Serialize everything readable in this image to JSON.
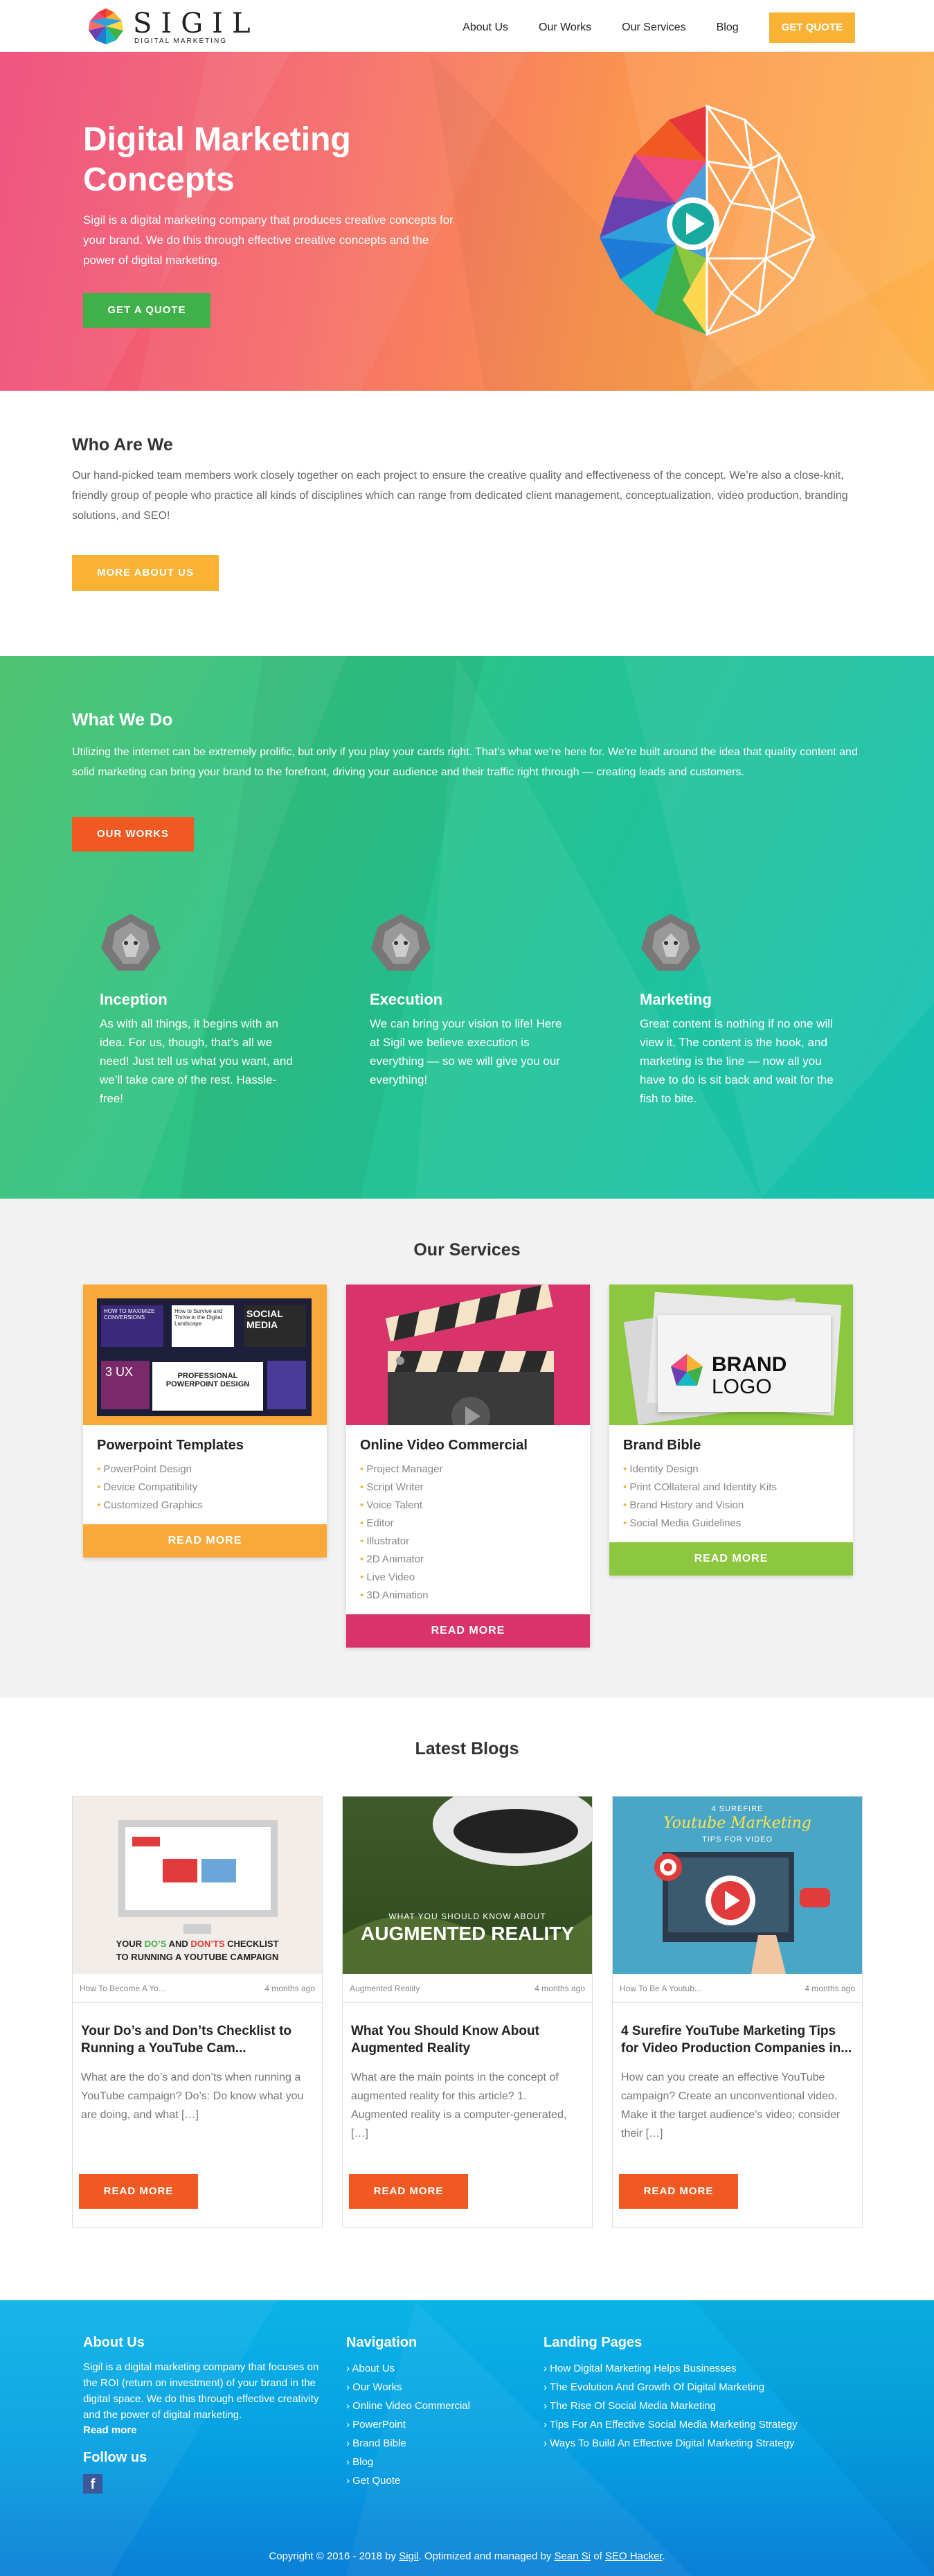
{
  "brand": {
    "name": "SIGIL",
    "tagline": "DIGITAL MARKETING"
  },
  "nav": {
    "about": "About Us",
    "works": "Our Works",
    "services": "Our Services",
    "blog": "Blog",
    "quote": "GET QUOTE"
  },
  "hero": {
    "title": "Digital Marketing Concepts",
    "text": "Sigil is a digital marketing company that produces creative concepts for your brand. We do this through effective creative concepts and the power of digital marketing.",
    "button": "GET A QUOTE"
  },
  "who": {
    "title": "Who Are We",
    "text": "Our hand-picked team members work closely together on each project to ensure the creative quality and effectiveness of the concept. We’re also a close-knit, friendly group of people who practice all kinds of disciplines which can range from dedicated client management, conceptualization, video production, branding solutions, and SEO!",
    "button": "MORE ABOUT US"
  },
  "what": {
    "title": "What We Do",
    "text": "Utilizing the internet can be extremely prolific, but only if you play your cards right. That’s what we’re here for. We’re built around the idea that quality content and solid marketing can bring your brand to the forefront, driving your audience and their traffic right through — creating leads and customers.",
    "button": "OUR WORKS",
    "features": [
      {
        "title": "Inception",
        "text": "As with all things, it begins with an idea. For us, though, that’s all we need! Just tell us what you want, and we’ll take care of the rest. Hassle-free!"
      },
      {
        "title": "Execution",
        "text": "We can bring your vision to life! Here at Sigil we believe execution is everything — so we will give you our everything!"
      },
      {
        "title": "Marketing",
        "text": "Great content is nothing if no one will view it. The content is the hook, and marketing is the line — now all you have to do is sit back and wait for the fish to bite."
      }
    ]
  },
  "services": {
    "title": "Our Services",
    "items": [
      {
        "title": "Powerpoint Templates",
        "list": [
          "PowerPoint Design",
          "Device Compatibility",
          "Customized Graphics"
        ],
        "button": "READ MORE",
        "color": "#f9a93a",
        "img": {
          "tiles": [
            "HOW TO MAXIMIZE CONVERSIONS",
            "How to Survive and Thrive in the Digital Landscape",
            "SOCIAL MEDIA",
            "3 UX",
            "PROFESSIONAL POWERPOINT DESIGN"
          ]
        }
      },
      {
        "title": "Online Video Commercial",
        "list": [
          "Project Manager",
          "Script Writer",
          "Voice Talent",
          "Editor",
          "Illustrator",
          "2D Animator",
          "Live Video",
          "3D Animation"
        ],
        "button": "READ MORE",
        "color": "#d8336a"
      },
      {
        "title": "Brand Bible",
        "list": [
          "Identity Design",
          "Print COllateral and Identity Kits",
          "Brand History and Vision",
          "Social Media Guidelines"
        ],
        "button": "READ MORE",
        "color": "#8dc63f",
        "img": {
          "line1": "BRAND",
          "line2": "LOGO"
        }
      }
    ]
  },
  "blogs": {
    "title": "Latest Blogs",
    "items": [
      {
        "category": "How To Become A Yo...",
        "date": "4 months ago",
        "title": "Your Do’s and Don’ts Checklist to Running a YouTube Cam...",
        "excerpt": "What are the do’s and don’ts when running a YouTube campaign? Do’s: Do know what you are doing, and what […]",
        "button": "READ MORE",
        "img": {
          "line1a": "YOUR ",
          "line1b": "DO’S",
          "line1c": " AND ",
          "line1d": "DON’TS",
          "line1e": " CHECKLIST",
          "line2": "TO RUNNING A YOUTUBE CAMPAIGN"
        }
      },
      {
        "category": "Augmented Reality",
        "date": "4 months ago",
        "title": "What You Should Know About Augmented Reality",
        "excerpt": "What are the main points in the concept of augmented reality for this article? 1. Augmented reality is a computer-generated, […]",
        "button": "READ MORE",
        "img": {
          "small": "WHAT YOU SHOULD KNOW ABOUT",
          "big": "AUGMENTED REALITY"
        }
      },
      {
        "category": "How To Be A Youtub...",
        "date": "4 months ago",
        "title": "4 Surefire YouTube Marketing Tips for Video Production Companies in...",
        "excerpt": "How can you create an effective YouTube campaign? Create an unconventional video. Make it the target audience’s video; consider their […]",
        "button": "READ MORE",
        "img": {
          "top": "4 SUREFIRE",
          "script": "Youtube Marketing",
          "sub": "TIPS FOR VIDEO"
        }
      }
    ]
  },
  "footer": {
    "about_title": "About Us",
    "about_text": "Sigil is a digital marketing company that focuses on the ROI (return on investment) of your brand in the digital space. We do this through effective creativity and the power of digital marketing.",
    "read_more": "Read more",
    "follow": "Follow us",
    "fb": "f",
    "nav_title": "Navigation",
    "nav_items": [
      "About Us",
      "Our Works",
      "Online Video Commercial",
      "PowerPoint",
      "Brand Bible",
      "Blog",
      "Get Quote"
    ],
    "landing_title": "Landing Pages",
    "landing_items": [
      "How Digital Marketing Helps Businesses",
      "The Evolution And Growth Of Digital Marketing",
      "The Rise Of Social Media Marketing",
      "Tips For An Effective Social Media Marketing Strategy",
      "Ways To Build An Effective Digital Marketing Strategy"
    ],
    "copy_pre": "Copyright © 2016 - 2018 by ",
    "copy_brand": "Sigil",
    "copy_mid": ". Optimized and managed by ",
    "copy_person": "Sean Si",
    "copy_of": " of ",
    "copy_company": "SEO Hacker",
    "copy_end": "."
  }
}
